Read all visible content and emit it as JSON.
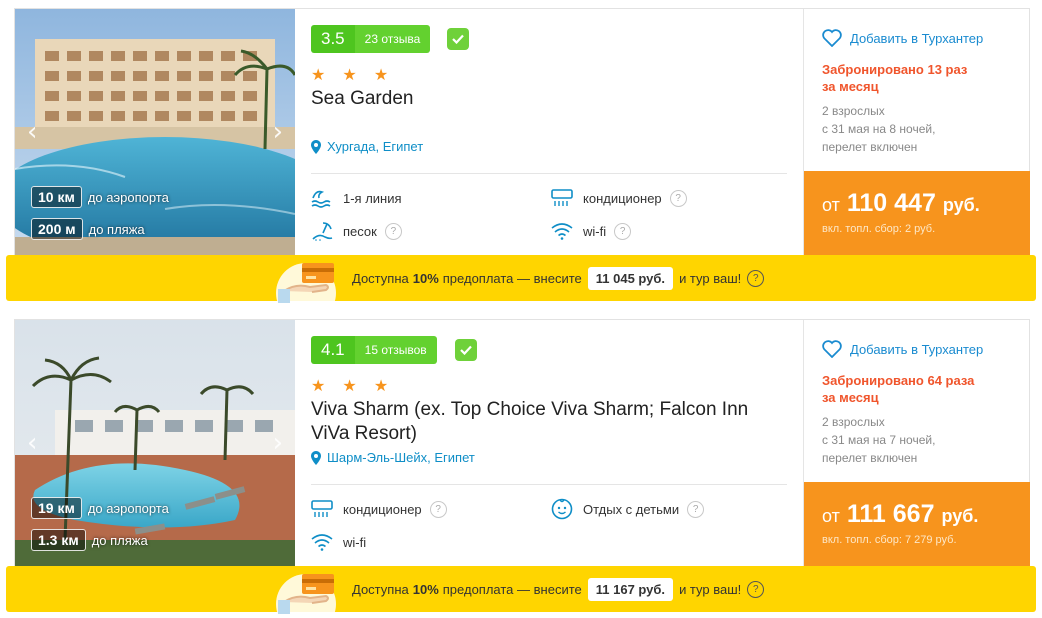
{
  "hotels": [
    {
      "rating": "3.5",
      "reviews": "23 отзыва",
      "stars": "★ ★ ★",
      "name": "Sea Garden",
      "location": "Хургада, Египет",
      "distances": [
        {
          "value": "10 км",
          "label": "до аэропорта"
        },
        {
          "value": "200 м",
          "label": "до пляжа"
        }
      ],
      "amenities": [
        {
          "icon": "wave-icon",
          "label": "1-я линия",
          "help": false
        },
        {
          "icon": "air-conditioner-icon",
          "label": "кондиционер",
          "help": true
        },
        {
          "icon": "sand-icon",
          "label": "песок",
          "help": true
        },
        {
          "icon": "wifi-icon",
          "label": "wi-fi",
          "help": true
        }
      ],
      "favorite": "Добавить в Турхантер",
      "booked": "Забронировано 13 раз за месяц",
      "pax_line1": "2 взрослых",
      "pax_line2": "с 31 мая на 8 ночей,",
      "pax_line3": "перелет включен",
      "price_prefix": "от",
      "price": "110 447",
      "currency": "руб.",
      "fee": "вкл. топл. сбор: 2 руб.",
      "banner": {
        "text1": "Доступна",
        "percent": "10%",
        "text2": "предоплата — внесите",
        "amount": "11 045 руб.",
        "text3": "и тур ваш!"
      }
    },
    {
      "rating": "4.1",
      "reviews": "15 отзывов",
      "stars": "★ ★ ★",
      "name": "Viva Sharm (ex. Top Choice Viva Sharm; Falcon Inn ViVa Resort)",
      "location": "Шарм-Эль-Шейх, Египет",
      "distances": [
        {
          "value": "19 км",
          "label": "до аэропорта"
        },
        {
          "value": "1.3 км",
          "label": "до пляжа"
        }
      ],
      "amenities": [
        {
          "icon": "air-conditioner-icon",
          "label": "кондиционер",
          "help": true
        },
        {
          "icon": "kids-icon",
          "label": "Отдых с детьми",
          "help": true
        },
        {
          "icon": "wifi-icon",
          "label": "wi-fi",
          "help": false
        }
      ],
      "favorite": "Добавить в Турхантер",
      "booked": "Забронировано 64 раза за месяц",
      "pax_line1": "2 взрослых",
      "pax_line2": "с 31 мая на 7 ночей,",
      "pax_line3": "перелет включен",
      "price_prefix": "от",
      "price": "111 667",
      "currency": "руб.",
      "fee": "вкл. топл. сбор: 7 279 руб.",
      "banner": {
        "text1": "Доступна",
        "percent": "10%",
        "text2": "предоплата — внесите",
        "amount": "11 167 руб.",
        "text3": "и тур ваш!"
      }
    }
  ],
  "ui": {
    "help_mark": "?",
    "arrow_left": "‹",
    "arrow_right": "›"
  },
  "colors": {
    "rating_green": "#4ec51f",
    "link_blue": "#1a8bd0",
    "price_orange": "#f7941d",
    "booked_red": "#f0552c",
    "banner_yellow": "#ffd500"
  }
}
